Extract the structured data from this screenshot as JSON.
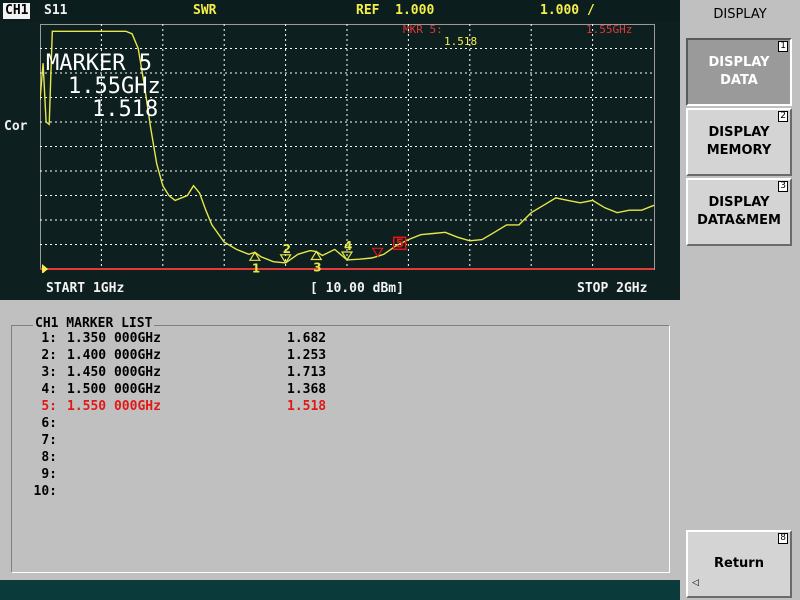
{
  "header": {
    "channel": "CH1",
    "parameter": "S11",
    "format": "SWR",
    "ref_label": "REF",
    "ref_value": "1.000",
    "scale": "1.000 /",
    "marker_label": "MKR 5:",
    "marker_value": "1.518",
    "marker_freq": "1.55GHz"
  },
  "side_label": "Cor",
  "overlay": {
    "title": "MARKER 5",
    "freq": "1.55GHz",
    "value": "1.518"
  },
  "sweep": {
    "start": "START 1GHz",
    "power": "[ 10.00 dBm]",
    "stop": "STOP 2GHz"
  },
  "marker_list": {
    "title": "CH1 MARKER LIST",
    "rows": [
      {
        "index": "1:",
        "freq": "1.350 000GHz",
        "value": "1.682",
        "active": false
      },
      {
        "index": "2:",
        "freq": "1.400 000GHz",
        "value": "1.253",
        "active": false
      },
      {
        "index": "3:",
        "freq": "1.450 000GHz",
        "value": "1.713",
        "active": false
      },
      {
        "index": "4:",
        "freq": "1.500 000GHz",
        "value": "1.368",
        "active": false
      },
      {
        "index": "5:",
        "freq": "1.550 000GHz",
        "value": "1.518",
        "active": true
      },
      {
        "index": "6:",
        "freq": "",
        "value": "",
        "active": false
      },
      {
        "index": "7:",
        "freq": "",
        "value": "",
        "active": false
      },
      {
        "index": "8:",
        "freq": "",
        "value": "",
        "active": false
      },
      {
        "index": "9:",
        "freq": "",
        "value": "",
        "active": false
      },
      {
        "index": "10:",
        "freq": "",
        "value": "",
        "active": false
      }
    ]
  },
  "softkeys": {
    "title": "DISPLAY",
    "keys": [
      {
        "label": "DISPLAY\nDATA",
        "number": "1",
        "selected": true
      },
      {
        "label": "DISPLAY\nMEMORY",
        "number": "2",
        "selected": false
      },
      {
        "label": "DISPLAY\nDATA&MEM",
        "number": "3",
        "selected": false
      },
      {
        "label": "Return",
        "number": "8",
        "selected": false
      }
    ]
  },
  "colors": {
    "trace": "#e6e64a",
    "grid": "#ffffff",
    "active_marker": "#e01818",
    "screen_bg": "#0d1f1f"
  },
  "chart_data": {
    "type": "line",
    "x_unit": "GHz",
    "xlim": [
      1.0,
      2.0
    ],
    "ylim": [
      1.0,
      11.0
    ],
    "grid": true,
    "series": [
      {
        "x": [
          1.0,
          1.005,
          1.01,
          1.015,
          1.02,
          1.03,
          1.05,
          1.08,
          1.1,
          1.12,
          1.14,
          1.15,
          1.16,
          1.17,
          1.18,
          1.19,
          1.2,
          1.21,
          1.22,
          1.24,
          1.25,
          1.26,
          1.27,
          1.28,
          1.3,
          1.32,
          1.34,
          1.35,
          1.36,
          1.38,
          1.4,
          1.42,
          1.44,
          1.45,
          1.46,
          1.48,
          1.5,
          1.52,
          1.54,
          1.55,
          1.56,
          1.58,
          1.6,
          1.62,
          1.64,
          1.66,
          1.68,
          1.7,
          1.72,
          1.74,
          1.76,
          1.78,
          1.8,
          1.82,
          1.84,
          1.86,
          1.88,
          1.9,
          1.92,
          1.94,
          1.96,
          1.98,
          2.0
        ],
        "y": [
          7.9,
          9.4,
          7.0,
          6.9,
          10.7,
          10.7,
          10.7,
          10.7,
          10.7,
          10.7,
          10.7,
          10.6,
          10.0,
          8.5,
          6.8,
          5.3,
          4.4,
          4.0,
          3.8,
          4.0,
          4.4,
          4.1,
          3.4,
          2.8,
          2.1,
          1.8,
          1.6,
          1.68,
          1.5,
          1.3,
          1.25,
          1.6,
          1.75,
          1.71,
          1.55,
          1.8,
          1.37,
          1.4,
          1.45,
          1.52,
          1.6,
          1.95,
          2.2,
          2.4,
          2.45,
          2.5,
          2.3,
          2.15,
          2.2,
          2.5,
          2.8,
          2.8,
          3.3,
          3.6,
          3.9,
          3.8,
          3.7,
          3.8,
          3.5,
          3.3,
          3.4,
          3.4,
          3.6
        ]
      }
    ],
    "markers": [
      {
        "id": "1",
        "x": 1.35,
        "y": 1.682
      },
      {
        "id": "2",
        "x": 1.4,
        "y": 1.253
      },
      {
        "id": "3",
        "x": 1.45,
        "y": 1.713
      },
      {
        "id": "4",
        "x": 1.5,
        "y": 1.368
      },
      {
        "id": "5",
        "x": 1.55,
        "y": 1.518,
        "active": true
      }
    ]
  }
}
